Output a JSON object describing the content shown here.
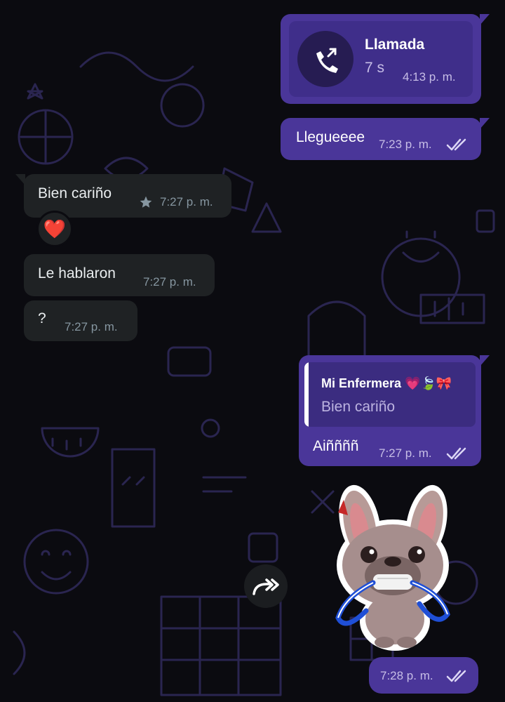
{
  "colors": {
    "outgoing_bubble": "#4a3699",
    "incoming_bubble": "#1f2224",
    "background": "#0b0b10",
    "quote_accent": "#ffffff"
  },
  "call_message": {
    "icon": "outgoing-call-icon",
    "title": "Llamada",
    "duration": "7 s",
    "time": "4:13 p. m."
  },
  "msg_llegueeee": {
    "text": "Llegueeee",
    "time": "7:23 p. m.",
    "status": "read-double-check"
  },
  "msg_bien_carino": {
    "text": "Bien cariño",
    "time": "7:27 p. m.",
    "starred": true,
    "reaction": "❤️"
  },
  "msg_le_hablaron": {
    "text": "Le hablaron",
    "time": "7:27 p. m."
  },
  "msg_question": {
    "text": "?",
    "time": "7:27 p. m."
  },
  "reply_message": {
    "quoted_author": "Mi Enfermera 💗🍃🎀",
    "quoted_text": "Bien cariño",
    "text": "Aiññññ",
    "time": "7:27 p. m.",
    "status": "read-double-check"
  },
  "sticker_message": {
    "sticker": "dog-with-leash-sticker",
    "time": "7:28 p. m.",
    "status": "read-double-check",
    "forward_icon": "forward-icon"
  }
}
